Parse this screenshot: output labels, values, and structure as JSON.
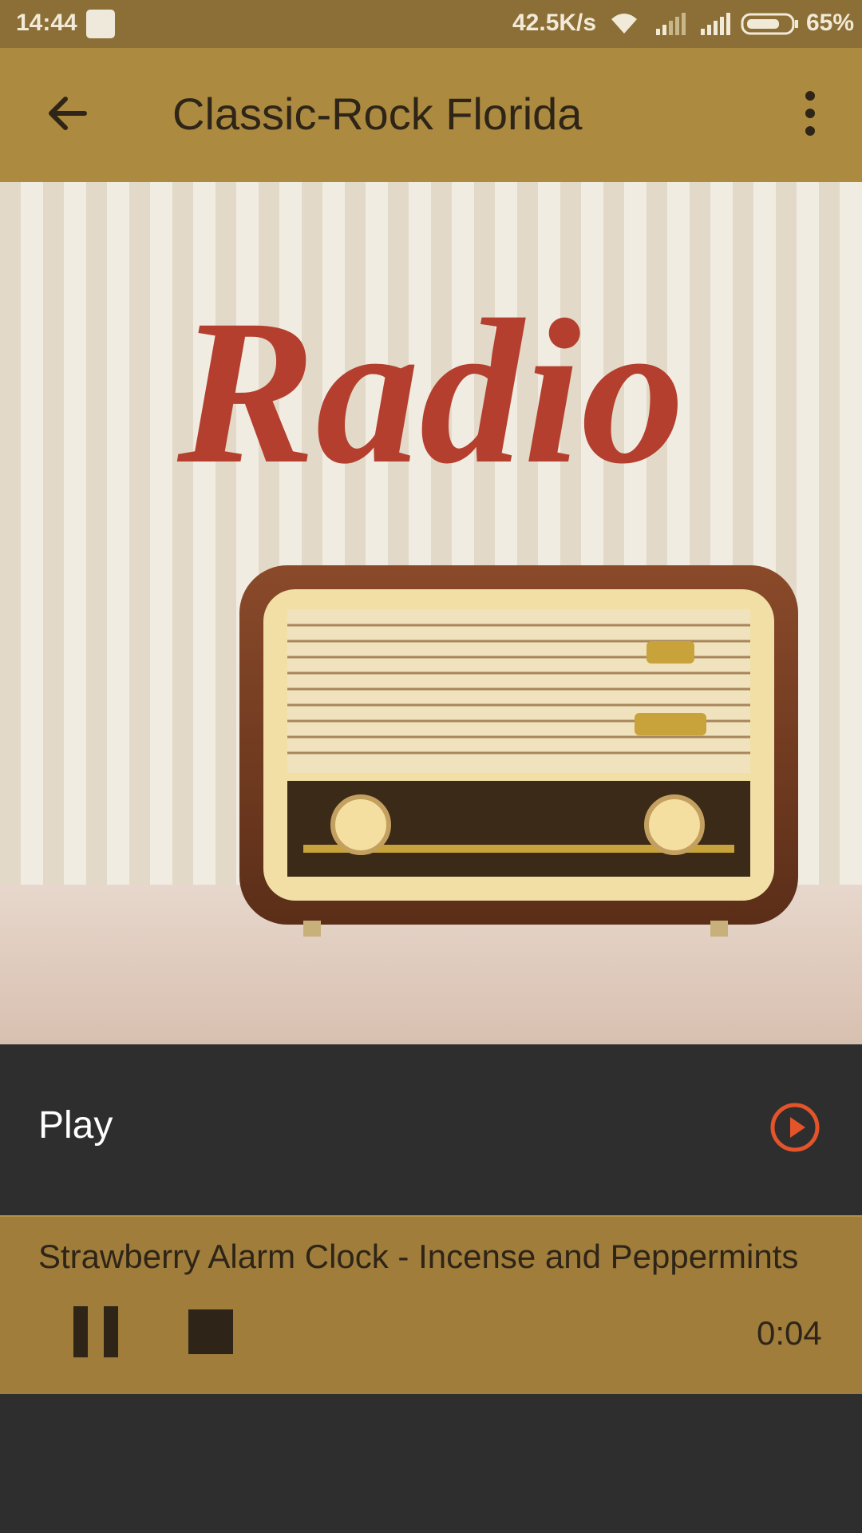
{
  "status_bar": {
    "time": "14:44",
    "net_speed": "42.5K/s",
    "battery": "65%"
  },
  "app_bar": {
    "title": "Classic-Rock Florida",
    "back_icon": "arrow-left-icon",
    "menu_icon": "more-vert-icon"
  },
  "artwork": {
    "text": "Radio"
  },
  "play_row": {
    "label": "Play",
    "icon": "play-circle-icon",
    "accent": "#e4542b"
  },
  "player": {
    "track": "Strawberry Alarm Clock -  Incense and Peppermints",
    "elapsed": "0:04",
    "pause_icon": "pause-icon",
    "stop_icon": "stop-icon"
  },
  "colors": {
    "status_bar": "#8b6f37",
    "app_bar": "#ac8a3f",
    "player_bg": "#a07d3b",
    "dark_bg": "#2f2e2e"
  }
}
